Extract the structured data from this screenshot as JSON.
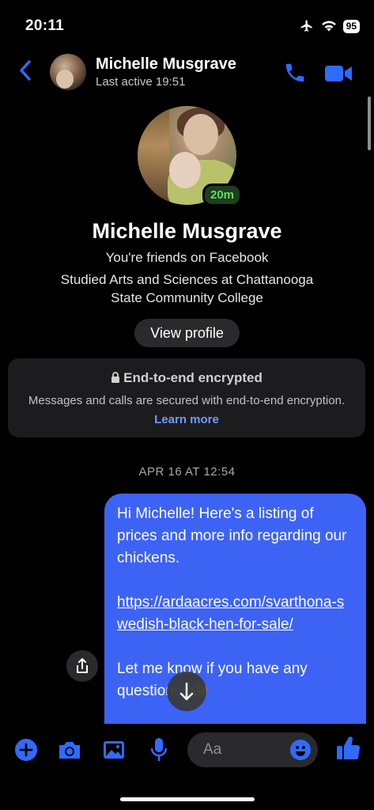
{
  "status_bar": {
    "time": "20:11",
    "battery": "95",
    "icons": [
      "airplane-icon",
      "wifi-icon",
      "battery-icon"
    ]
  },
  "header": {
    "back_icon": "chevron-left-icon",
    "name": "Michelle Musgrave",
    "subtitle": "Last active 19:51",
    "call_icon": "phone-icon",
    "video_icon": "video-camera-icon"
  },
  "profile": {
    "active_badge": "20m",
    "name": "Michelle Musgrave",
    "friends_line": "You're friends on Facebook",
    "education_line_1": "Studied Arts and Sciences at Chattanooga",
    "education_line_2": "State Community College",
    "view_profile_label": "View profile"
  },
  "encryption": {
    "title": "End-to-end encrypted",
    "body": "Messages and calls are secured with end-to-end encryption.",
    "link": "Learn more"
  },
  "conversation": {
    "date_divider": "APR 16 AT 12:54",
    "message": {
      "line_1": "Hi Michelle! Here's a listing of prices and more info regarding our chickens.",
      "url": "https://ardaacres.com/svarthona-swedish-black-hen-for-sale/",
      "line_2": "Let me know if you have any questions. 🙂"
    }
  },
  "composer": {
    "placeholder": "Aa",
    "icons": [
      "plus-circle-icon",
      "camera-icon",
      "image-icon",
      "microphone-icon",
      "emoji-icon",
      "thumbs-up-icon"
    ]
  },
  "colors": {
    "accent": "#3d63f5",
    "icon_blue": "#2f6bff",
    "link": "#6f9bff",
    "online_green": "#5fdc5f"
  }
}
